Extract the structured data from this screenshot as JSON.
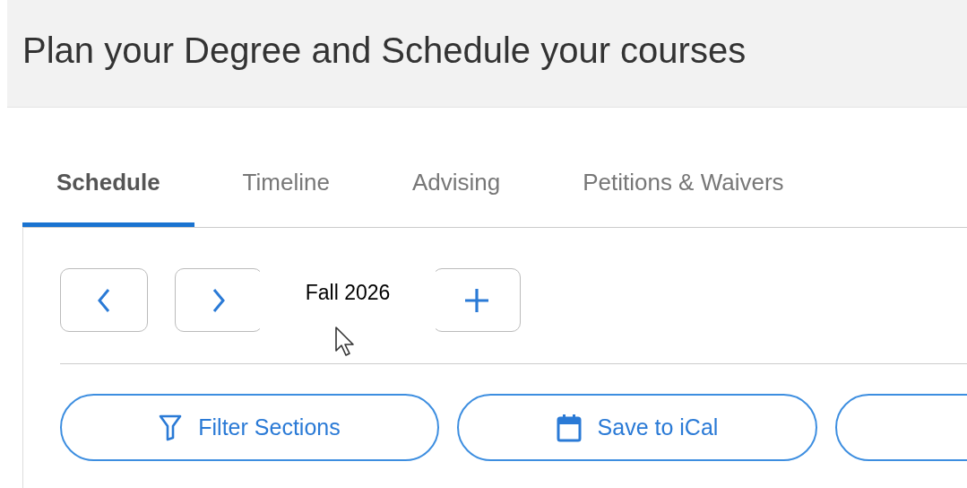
{
  "header": {
    "title": "Plan your Degree and Schedule your courses"
  },
  "tabs": [
    {
      "label": "Schedule",
      "selected": true
    },
    {
      "label": "Timeline",
      "selected": false
    },
    {
      "label": "Advising",
      "selected": false
    },
    {
      "label": "Petitions & Waivers",
      "selected": false
    }
  ],
  "term_nav": {
    "term_label": "Fall 2026"
  },
  "actions": [
    {
      "kind": "filter",
      "label": "Filter Sections"
    },
    {
      "kind": "calendar",
      "label": "Save to iCal"
    }
  ]
}
